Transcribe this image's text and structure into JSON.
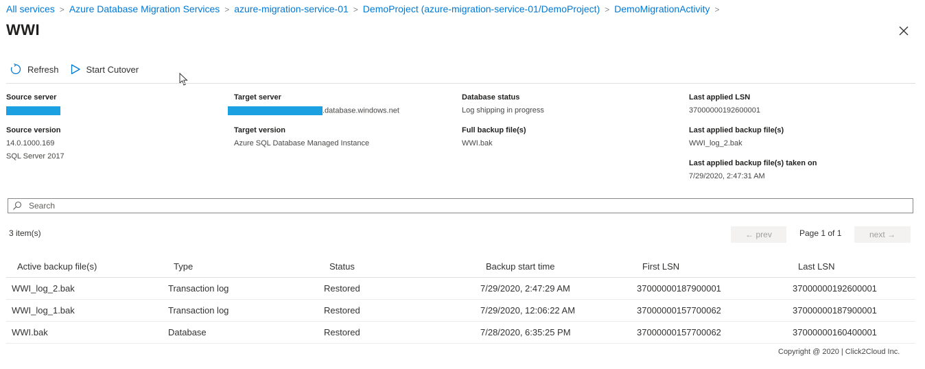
{
  "breadcrumb": {
    "items": [
      "All services",
      "Azure Database Migration Services",
      "azure-migration-service-01",
      "DemoProject (azure-migration-service-01/DemoProject)",
      "DemoMigrationActivity"
    ],
    "separator": ">"
  },
  "page": {
    "title": "WWI"
  },
  "toolbar": {
    "refresh_label": "Refresh",
    "start_cutover_label": "Start Cutover"
  },
  "info": {
    "source_server_label": "Source server",
    "source_version_label": "Source version",
    "source_version_line1": "14.0.1000.169",
    "source_version_line2": "SQL Server 2017",
    "target_server_label": "Target server",
    "target_server_suffix": ".database.windows.net",
    "target_version_label": "Target version",
    "target_version_value": "Azure SQL Database Managed Instance",
    "database_status_label": "Database status",
    "database_status_value": "Log shipping in progress",
    "full_backup_label": "Full backup file(s)",
    "full_backup_value": "WWI.bak",
    "last_lsn_label": "Last applied LSN",
    "last_lsn_value": "37000000192600001",
    "last_backup_label": "Last applied backup file(s)",
    "last_backup_value": "WWI_log_2.bak",
    "last_backup_taken_label": "Last applied backup file(s) taken on",
    "last_backup_taken_value": "7/29/2020, 2:47:31 AM"
  },
  "search": {
    "placeholder": "Search"
  },
  "list": {
    "count": "3 item(s)",
    "prev_label": "← prev",
    "next_label": "next →",
    "page_label": "Page 1 of 1",
    "columns": [
      "Active backup file(s)",
      "Type",
      "Status",
      "Backup start time",
      "First LSN",
      "Last LSN"
    ],
    "rows": [
      [
        "WWI_log_2.bak",
        "Transaction log",
        "Restored",
        "7/29/2020, 2:47:29 AM",
        "37000000187900001",
        "37000000192600001"
      ],
      [
        "WWI_log_1.bak",
        "Transaction log",
        "Restored",
        "7/29/2020, 12:06:22 AM",
        "37000000157700062",
        "37000000187900001"
      ],
      [
        "WWI.bak",
        "Database",
        "Restored",
        "7/28/2020, 6:35:25 PM",
        "37000000157700062",
        "37000000160400001"
      ]
    ]
  },
  "footer": {
    "copyright": "Copyright @ 2020 |   Click2Cloud Inc."
  },
  "colors": {
    "link": "#0078d4",
    "redaction": "#1ba1e2",
    "border": "#e1dfdd",
    "disabled_button_bg": "#f3f2f1"
  },
  "icons": [
    "close-icon",
    "refresh-icon",
    "play-icon",
    "search-icon",
    "mouse-cursor-icon"
  ]
}
